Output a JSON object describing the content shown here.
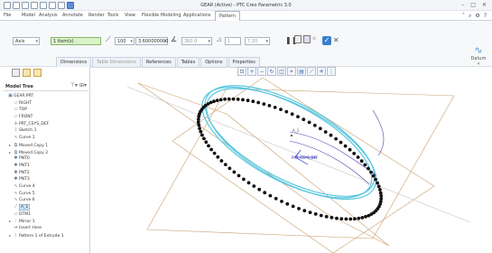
{
  "window": {
    "title": "GEAR (Active) - PTC Creo Parametric 3.0"
  },
  "menu": {
    "tabs": [
      {
        "label": "File"
      },
      {
        "label": "Model"
      },
      {
        "label": "Analysis"
      },
      {
        "label": "Annotate"
      },
      {
        "label": "Render"
      },
      {
        "label": "Tools"
      },
      {
        "label": "View"
      },
      {
        "label": "Flexible Modeling"
      },
      {
        "label": "Applications"
      },
      {
        "label": "Pattern"
      }
    ],
    "active_tab": "Pattern"
  },
  "pattern_dashboard": {
    "type_value": "Axis",
    "reference_value": "1 item(s)",
    "member_count": "100",
    "angle_value": "3.600000000",
    "total_angle_value": "360.0",
    "second_direction_count": "1",
    "second_direction_spacing": "7.20",
    "datum_label": "Datum",
    "subtabs": [
      {
        "label": "Dimensions"
      },
      {
        "label": "Table Dimensions"
      },
      {
        "label": "References"
      },
      {
        "label": "Tables"
      },
      {
        "label": "Options"
      },
      {
        "label": "Properties"
      }
    ]
  },
  "model_tree": {
    "header": "Model Tree",
    "items": [
      {
        "label": "GEAR.PRT",
        "icon": "part-icon",
        "expander": ""
      },
      {
        "label": "RIGHT",
        "icon": "datum-plane-icon",
        "expander": ""
      },
      {
        "label": "TOP",
        "icon": "datum-plane-icon",
        "expander": ""
      },
      {
        "label": "FRONT",
        "icon": "datum-plane-icon",
        "expander": ""
      },
      {
        "label": "PRT_CSYS_DEF",
        "icon": "csys-icon",
        "expander": ""
      },
      {
        "label": "Sketch 1",
        "icon": "sketch-icon",
        "expander": ""
      },
      {
        "label": "Curve 1",
        "icon": "curve-icon",
        "expander": ""
      },
      {
        "label": "Moved Copy 1",
        "icon": "moved-copy-icon",
        "expander": "▸"
      },
      {
        "label": "Moved Copy 2",
        "icon": "moved-copy-icon",
        "expander": "▸"
      },
      {
        "label": "PNT0",
        "icon": "datum-point-icon",
        "expander": ""
      },
      {
        "label": "PNT1",
        "icon": "datum-point-icon",
        "expander": ""
      },
      {
        "label": "PNT2",
        "icon": "datum-point-icon",
        "expander": ""
      },
      {
        "label": "PNT3",
        "icon": "datum-point-icon",
        "expander": ""
      },
      {
        "label": "Curve 4",
        "icon": "curve-icon",
        "expander": ""
      },
      {
        "label": "Curve 5",
        "icon": "curve-icon",
        "expander": ""
      },
      {
        "label": "Curve 6",
        "icon": "curve-icon",
        "expander": ""
      },
      {
        "label": "A_1",
        "icon": "datum-axis-icon",
        "expander": "",
        "selected": true
      },
      {
        "label": "DTM1",
        "icon": "datum-plane-icon",
        "expander": ""
      },
      {
        "label": "Mirror 1",
        "icon": "mirror-icon",
        "expander": "▸"
      },
      {
        "label": "Insert Here",
        "icon": "insert-here-icon",
        "expander": ""
      },
      {
        "label": "Pattern 1 of Extrude 1",
        "icon": "pattern-icon",
        "expander": "▸"
      }
    ]
  },
  "canvas": {
    "labels": {
      "axis": "A_1",
      "csys": "PRT_CSYS_DEF"
    },
    "colors": {
      "gear_ring": "#5bc7e0",
      "pattern_dots": "#111111",
      "datum_planes": "#c8a070",
      "curve": "#4a3fb0"
    }
  }
}
